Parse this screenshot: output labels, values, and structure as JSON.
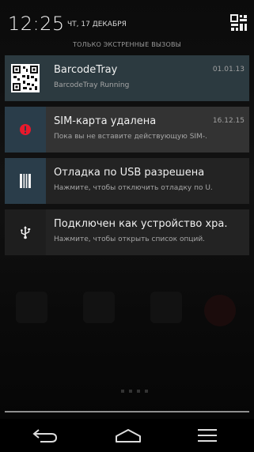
{
  "status": {
    "time": "12:25",
    "date": "ЧТ, 17 ДЕКАБРЯ",
    "emergency_only": "ТОЛЬКО ЭКСТРЕННЫЕ ВЫЗОВЫ"
  },
  "notifications": [
    {
      "icon": "qr-code-icon",
      "title": "BarcodeTray",
      "text": "BarcodeTray Running",
      "time": "01.01.13"
    },
    {
      "icon": "sim-alert-icon",
      "title": "SIM-карта удалена",
      "text": "Пока вы не вставите действующую SIM-.",
      "time": "16.12.15"
    },
    {
      "icon": "usb-debug-icon",
      "title": "Отладка по USB разрешена",
      "text": "Нажмите, чтобы отключить отладку по U."
    },
    {
      "icon": "usb-icon",
      "title": "Подключен как устройство хра.",
      "text": "Нажмите, чтобы открыть список опций."
    }
  ],
  "colors": {
    "alert_red": "#e8192c",
    "shade_bg": "#0b0b0b",
    "notif_bg": "#232323"
  },
  "navbar": {
    "back_icon": "back-icon",
    "home_icon": "home-icon",
    "recent_icon": "recent-apps-icon"
  }
}
